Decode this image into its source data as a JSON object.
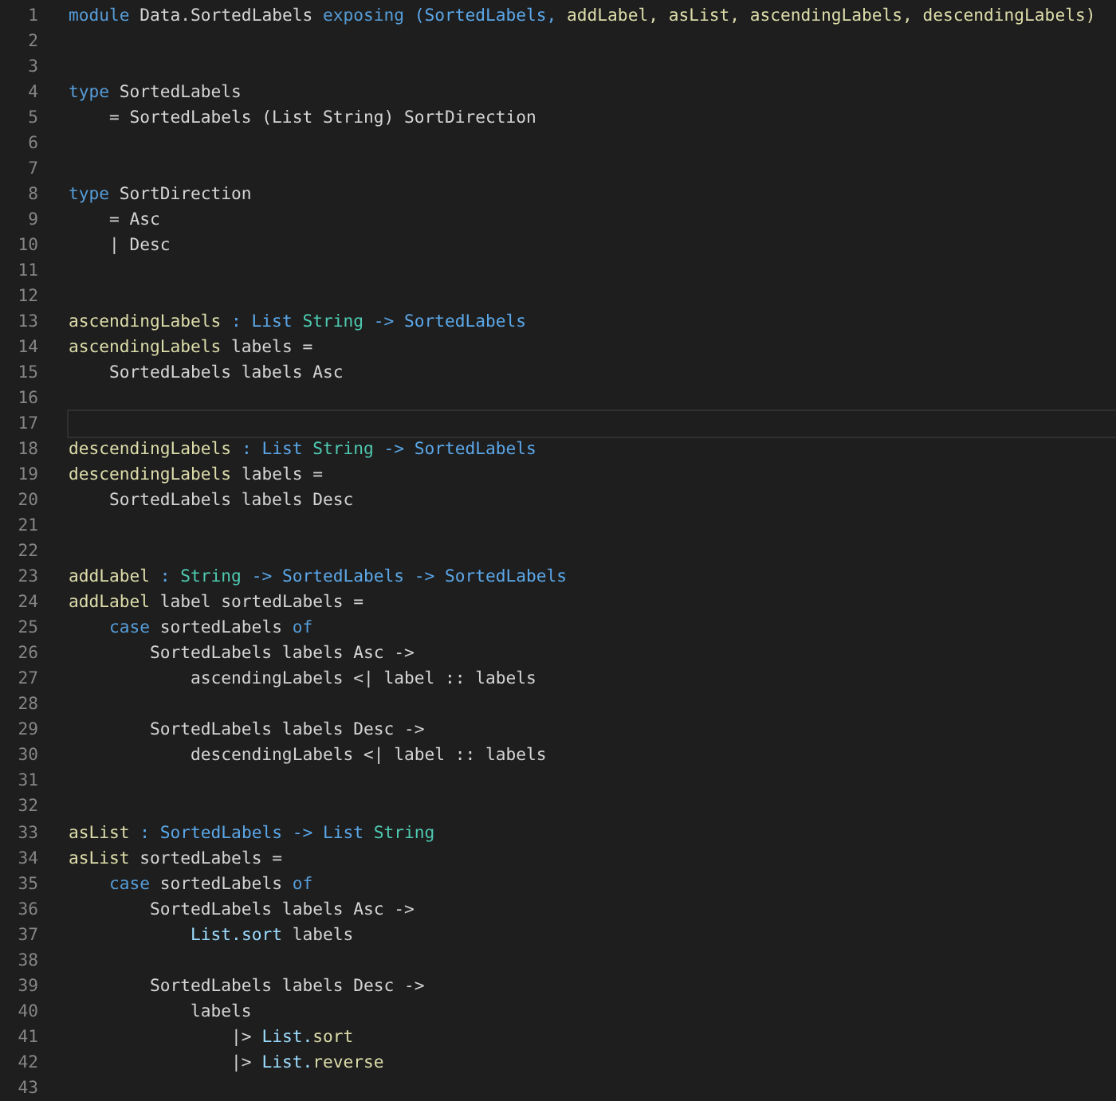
{
  "lines": [
    {
      "number": "1",
      "tokens": [
        {
          "kind": "keyword",
          "text": "module "
        },
        {
          "kind": "plain",
          "text": "Data.SortedLabels "
        },
        {
          "kind": "keyword",
          "text": "exposing "
        },
        {
          "kind": "type",
          "text": "(SortedLabels, "
        },
        {
          "kind": "function",
          "text": "addLabel, asList, ascendingLabels, descendingLabels)"
        }
      ]
    },
    {
      "number": "2"
    },
    {
      "number": "3"
    },
    {
      "number": "4",
      "tokens": [
        {
          "kind": "keyword",
          "text": "type "
        },
        {
          "kind": "plain",
          "text": "SortedLabels"
        }
      ]
    },
    {
      "number": "5",
      "tokens": [
        {
          "kind": "plain",
          "text": "    = SortedLabels (List String) SortDirection"
        }
      ]
    },
    {
      "number": "6"
    },
    {
      "number": "7"
    },
    {
      "number": "8",
      "tokens": [
        {
          "kind": "keyword",
          "text": "type "
        },
        {
          "kind": "plain",
          "text": "SortDirection"
        }
      ]
    },
    {
      "number": "9",
      "tokens": [
        {
          "kind": "plain",
          "text": "    = Asc"
        }
      ]
    },
    {
      "number": "10",
      "tokens": [
        {
          "kind": "plain",
          "text": "    | Desc"
        }
      ]
    },
    {
      "number": "11"
    },
    {
      "number": "12"
    },
    {
      "number": "13",
      "tokens": [
        {
          "kind": "function",
          "text": "ascendingLabels"
        },
        {
          "kind": "type",
          "text": " : List "
        },
        {
          "kind": "builtin",
          "text": "String"
        },
        {
          "kind": "type",
          "text": " -> SortedLabels"
        }
      ]
    },
    {
      "number": "14",
      "tokens": [
        {
          "kind": "function",
          "text": "ascendingLabels"
        },
        {
          "kind": "plain",
          "text": " labels ="
        }
      ]
    },
    {
      "number": "15",
      "tokens": [
        {
          "kind": "plain",
          "text": "    SortedLabels labels Asc"
        }
      ]
    },
    {
      "number": "16"
    },
    {
      "number": "17",
      "current": true
    },
    {
      "number": "18",
      "tokens": [
        {
          "kind": "function",
          "text": "descendingLabels"
        },
        {
          "kind": "type",
          "text": " : List "
        },
        {
          "kind": "builtin",
          "text": "String"
        },
        {
          "kind": "type",
          "text": " -> SortedLabels"
        }
      ]
    },
    {
      "number": "19",
      "tokens": [
        {
          "kind": "function",
          "text": "descendingLabels"
        },
        {
          "kind": "plain",
          "text": " labels ="
        }
      ]
    },
    {
      "number": "20",
      "tokens": [
        {
          "kind": "plain",
          "text": "    SortedLabels labels Desc"
        }
      ]
    },
    {
      "number": "21"
    },
    {
      "number": "22"
    },
    {
      "number": "23",
      "tokens": [
        {
          "kind": "function",
          "text": "addLabel"
        },
        {
          "kind": "type",
          "text": " : "
        },
        {
          "kind": "builtin",
          "text": "String"
        },
        {
          "kind": "type",
          "text": " -> SortedLabels -> SortedLabels"
        }
      ]
    },
    {
      "number": "24",
      "tokens": [
        {
          "kind": "function",
          "text": "addLabel"
        },
        {
          "kind": "plain",
          "text": " label sortedLabels ="
        }
      ]
    },
    {
      "number": "25",
      "tokens": [
        {
          "kind": "keyword",
          "text": "    case"
        },
        {
          "kind": "plain",
          "text": " sortedLabels "
        },
        {
          "kind": "keyword",
          "text": "of"
        }
      ]
    },
    {
      "number": "26",
      "tokens": [
        {
          "kind": "plain",
          "text": "        SortedLabels labels Asc ->"
        }
      ]
    },
    {
      "number": "27",
      "tokens": [
        {
          "kind": "plain",
          "text": "            ascendingLabels <| label :: labels"
        }
      ]
    },
    {
      "number": "28"
    },
    {
      "number": "29",
      "tokens": [
        {
          "kind": "plain",
          "text": "        SortedLabels labels Desc ->"
        }
      ]
    },
    {
      "number": "30",
      "tokens": [
        {
          "kind": "plain",
          "text": "            descendingLabels <| label :: labels"
        }
      ]
    },
    {
      "number": "31"
    },
    {
      "number": "32"
    },
    {
      "number": "33",
      "tokens": [
        {
          "kind": "function",
          "text": "asList"
        },
        {
          "kind": "type",
          "text": " : SortedLabels -> List "
        },
        {
          "kind": "builtin",
          "text": "String"
        }
      ]
    },
    {
      "number": "34",
      "tokens": [
        {
          "kind": "function",
          "text": "asList"
        },
        {
          "kind": "plain",
          "text": " sortedLabels ="
        }
      ]
    },
    {
      "number": "35",
      "tokens": [
        {
          "kind": "keyword",
          "text": "    case"
        },
        {
          "kind": "plain",
          "text": " sortedLabels "
        },
        {
          "kind": "keyword",
          "text": "of"
        }
      ]
    },
    {
      "number": "36",
      "tokens": [
        {
          "kind": "plain",
          "text": "        SortedLabels labels Asc ->"
        }
      ]
    },
    {
      "number": "37",
      "tokens": [
        {
          "kind": "module",
          "text": "            List."
        },
        {
          "kind": "module",
          "text": "sort"
        },
        {
          "kind": "plain",
          "text": " labels"
        }
      ]
    },
    {
      "number": "38"
    },
    {
      "number": "39",
      "tokens": [
        {
          "kind": "plain",
          "text": "        SortedLabels labels Desc ->"
        }
      ]
    },
    {
      "number": "40",
      "tokens": [
        {
          "kind": "plain",
          "text": "            labels"
        }
      ]
    },
    {
      "number": "41",
      "tokens": [
        {
          "kind": "plain",
          "text": "                |> "
        },
        {
          "kind": "module",
          "text": "List."
        },
        {
          "kind": "function",
          "text": "sort"
        }
      ]
    },
    {
      "number": "42",
      "tokens": [
        {
          "kind": "plain",
          "text": "                |> "
        },
        {
          "kind": "module",
          "text": "List."
        },
        {
          "kind": "function",
          "text": "reverse"
        }
      ]
    },
    {
      "number": "43"
    }
  ]
}
